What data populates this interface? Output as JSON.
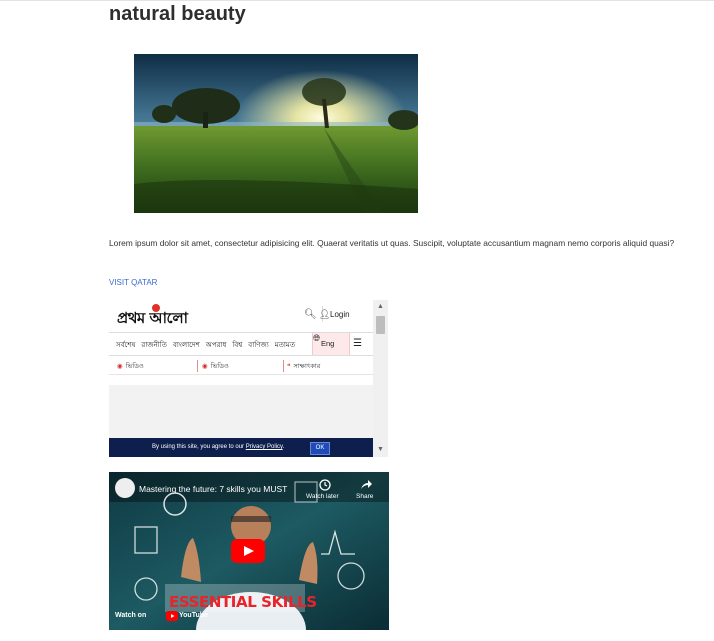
{
  "page": {
    "title": "natural beauty",
    "hero_image_label": "landscape with trees at sunset",
    "paragraph": "Lorem ipsum dolor sit amet, consectetur adipisicing elit. Quaerat veritatis ut quas. Suscipit, voluptate accusantium magnam nemo corporis aliquid quasi?",
    "link_label": "VISIT QATAR"
  },
  "news_frame": {
    "logo_text": "প্রথম আলো",
    "login_label": "Login",
    "nav_items": [
      "সর্বশেষ",
      "রাজনীতি",
      "বাংলাদেশ",
      "অপরাধ",
      "বিশ্ব",
      "বাণিজ্য",
      "মতামত"
    ],
    "lang_label": "Eng",
    "video_row": [
      {
        "label": "ভিডিও"
      },
      {
        "label": "ভিডিও"
      },
      {
        "label": "সাক্ষাৎকার"
      }
    ],
    "cookie": {
      "prefix": "By using this site, you agree to our ",
      "policy": "Privacy Policy",
      "suffix": ".",
      "ok": "OK"
    }
  },
  "video": {
    "title": "Mastering the future: 7 skills you MUST",
    "watch_later": "Watch later",
    "share": "Share",
    "banner": "ESSENTIAL SKILLS",
    "watch_on": "Watch on",
    "platform": "YouTube",
    "accent": "#ff0000"
  }
}
